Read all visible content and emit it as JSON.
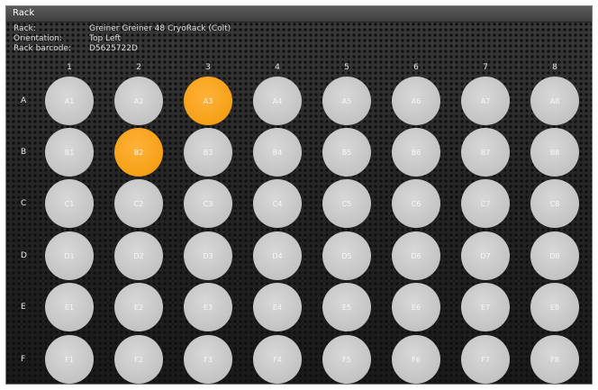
{
  "window": {
    "title": "Rack"
  },
  "info": {
    "rack_label": "Rack:",
    "rack_value": "Greiner Greiner 48 CryoRack (Colt)",
    "orientation_label": "Orientation:",
    "orientation_value": "Top Left",
    "barcode_label": "Rack barcode:",
    "barcode_value": "D5625722D"
  },
  "columns": [
    "1",
    "2",
    "3",
    "4",
    "5",
    "6",
    "7",
    "8"
  ],
  "rows": [
    "A",
    "B",
    "C",
    "D",
    "E",
    "F"
  ],
  "selected_wells": [
    "A3",
    "B2"
  ],
  "colors": {
    "well": "#c8c8c8",
    "selected_well": "#f5a016",
    "background": "#2b2b2b"
  }
}
